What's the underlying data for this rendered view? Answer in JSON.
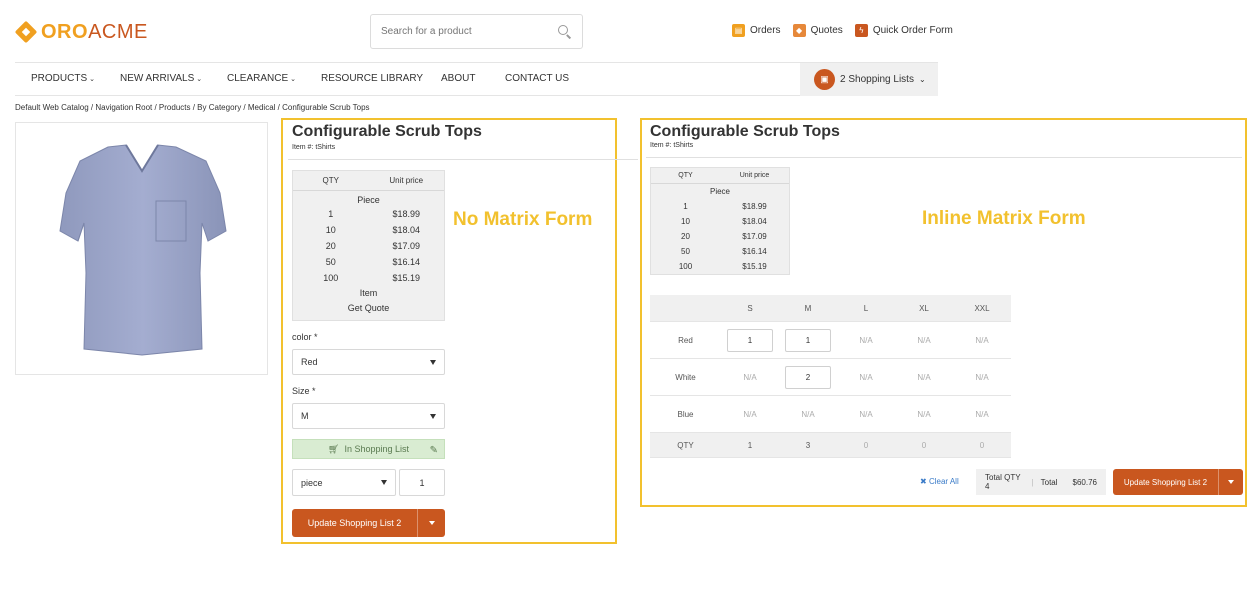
{
  "header": {
    "logo_oro": "ORO",
    "logo_acme": "ACME",
    "search_placeholder": "Search for a product",
    "links": [
      {
        "label": "Orders",
        "icon": "orders-icon"
      },
      {
        "label": "Quotes",
        "icon": "quotes-icon"
      },
      {
        "label": "Quick Order Form",
        "icon": "quick-order-icon"
      }
    ]
  },
  "nav": {
    "items": [
      "PRODUCTS",
      "NEW ARRIVALS",
      "CLEARANCE",
      "RESOURCE LIBRARY",
      "ABOUT",
      "CONTACT US"
    ],
    "shopping_lists": "2 Shopping Lists"
  },
  "breadcrumb": "Default Web Catalog / Navigation Root / Products / By Category / Medical / Configurable Scrub Tops",
  "product": {
    "title": "Configurable Scrub Tops",
    "item_no": "Item #: tShirts"
  },
  "price_table": {
    "col_qty": "QTY",
    "col_price": "Unit price",
    "unit_piece": "Piece",
    "rows": [
      {
        "qty": "1",
        "price": "$18.99"
      },
      {
        "qty": "10",
        "price": "$18.04"
      },
      {
        "qty": "20",
        "price": "$17.09"
      },
      {
        "qty": "50",
        "price": "$16.14"
      },
      {
        "qty": "100",
        "price": "$15.19"
      }
    ],
    "unit_item": "Item",
    "get_quote": "Get Quote"
  },
  "no_matrix": {
    "annotation": "No Matrix Form",
    "color_label": "color *",
    "color_value": "Red",
    "size_label": "Size *",
    "size_value": "M",
    "in_list": "In Shopping List",
    "unit_value": "piece",
    "qty_value": "1",
    "button": "Update Shopping List 2"
  },
  "inline_matrix": {
    "annotation": "Inline Matrix Form",
    "sizes": [
      "S",
      "M",
      "L",
      "XL",
      "XXL"
    ],
    "rows": [
      {
        "color": "Red",
        "cells": [
          "1",
          "1",
          "N/A",
          "N/A",
          "N/A"
        ]
      },
      {
        "color": "White",
        "cells": [
          "N/A",
          "2",
          "N/A",
          "N/A",
          "N/A"
        ]
      },
      {
        "color": "Blue",
        "cells": [
          "N/A",
          "N/A",
          "N/A",
          "N/A",
          "N/A"
        ]
      }
    ],
    "qty_label": "QTY",
    "qty_totals": [
      "1",
      "3",
      "0",
      "0",
      "0"
    ],
    "clear_all": "Clear All",
    "total_qty": "Total QTY 4",
    "total_label": "Total",
    "total_value": "$60.76",
    "button": "Update Shopping List 2"
  },
  "colors": {
    "accent": "#c9571f",
    "annotation": "#f2c12e",
    "in_list_bg": "#d9ecd2"
  }
}
